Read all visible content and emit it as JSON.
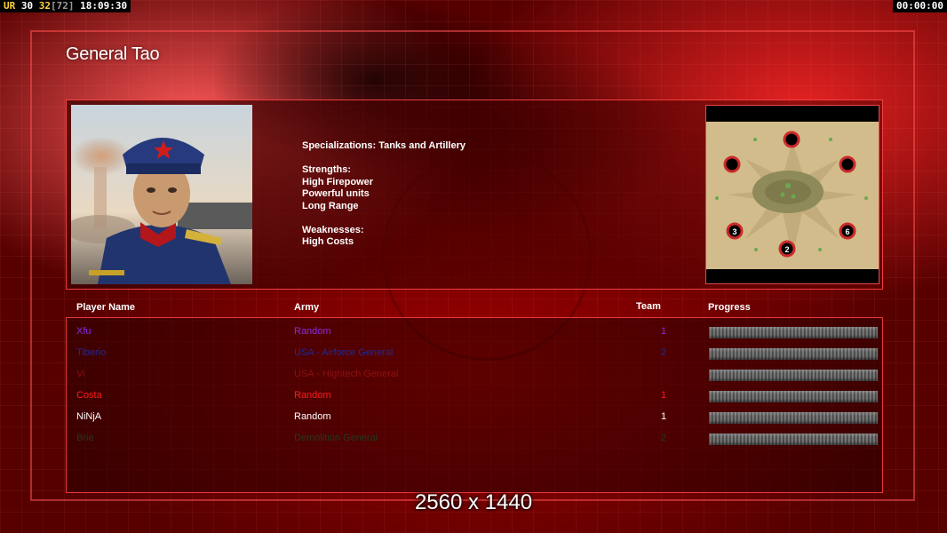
{
  "hud": {
    "prefix": "UR ",
    "fps": "30 ",
    "fps_target": "32",
    "fps_max": "[72]",
    "clock": " 18:09:30",
    "timer": "00:00:00"
  },
  "title": "General Tao",
  "description": {
    "specializations": "Specializations: Tanks and Artillery",
    "strengths_header": "Strengths:",
    "strengths": [
      "High Firepower",
      "Powerful units",
      "Long Range"
    ],
    "weaknesses_header": "Weaknesses:",
    "weaknesses": [
      "High Costs"
    ]
  },
  "columns": {
    "player_name": "Player Name",
    "army": "Army",
    "team": "Team",
    "progress": "Progress"
  },
  "minimap": {
    "slots": [
      "3",
      "2",
      "6"
    ]
  },
  "players": [
    {
      "name": "Xfu",
      "army": "Random",
      "team": "1",
      "color": "#8a2be2",
      "progress": 1.0
    },
    {
      "name": "Tiberio",
      "army": "USA - Airforce General",
      "team": "2",
      "color": "#1e2a9a",
      "progress": 1.0
    },
    {
      "name": "Vi",
      "army": "USA - Hightech General",
      "team": "",
      "color": "#8e1010",
      "progress": 1.0
    },
    {
      "name": "Costa",
      "army": "Random",
      "team": "1",
      "color": "#ff1c1c",
      "progress": 1.0
    },
    {
      "name": "NiNjA",
      "army": "Random",
      "team": "1",
      "color": "#ffffff",
      "progress": 1.0
    },
    {
      "name": "Brie",
      "army": "Demolition General",
      "team": "2",
      "color": "#1f3b1f",
      "progress": 1.0
    }
  ],
  "resolution_label": "2560 x 1440"
}
